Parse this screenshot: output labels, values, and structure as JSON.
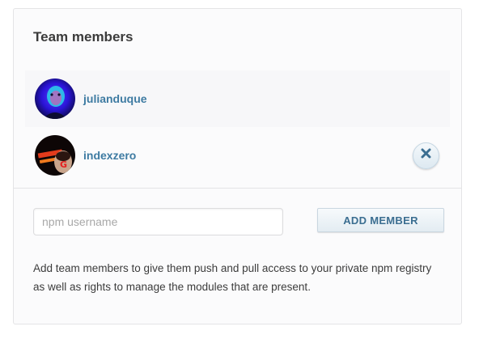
{
  "panel": {
    "title": "Team members"
  },
  "members": [
    {
      "username": "julianduque",
      "avatar": "avatar-blue-portrait",
      "removable": false
    },
    {
      "username": "indexzero",
      "avatar": "avatar-dark-red-portrait",
      "removable": true
    }
  ],
  "remove_button": {
    "icon": "close-icon"
  },
  "add_form": {
    "input_placeholder": "npm username",
    "input_value": "",
    "button_label": "ADD MEMBER"
  },
  "help_text": "Add team members to give them push and pull access to your private npm registry as well as rights to manage the modules that are present.",
  "colors": {
    "link": "#3e7ba2",
    "button_text": "#3b6e91",
    "panel_bg": "#fbfbfc",
    "border": "#e4e4e6"
  }
}
